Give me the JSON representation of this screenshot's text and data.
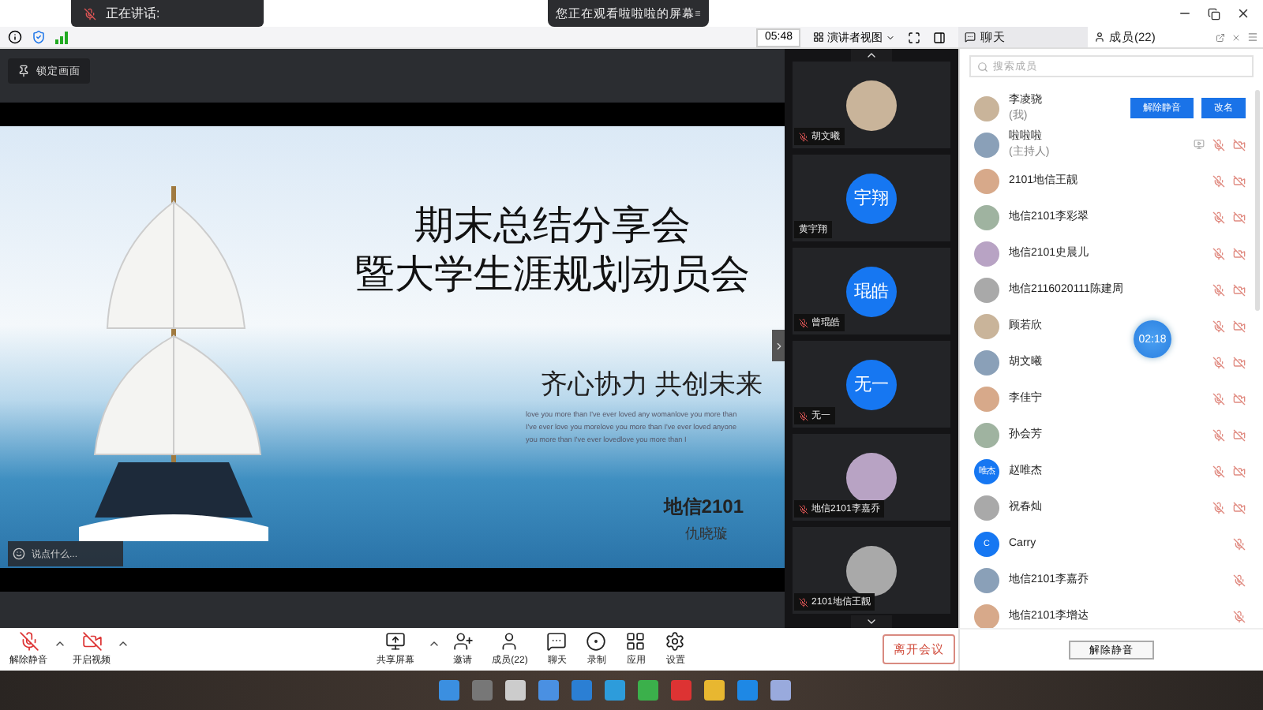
{
  "top_bar": {
    "speaking_label": "正在讲话:",
    "screen_banner": "您正在观看啦啦啦的屏幕"
  },
  "toolbar": {
    "timer": "05:48",
    "view_mode": "演讲者视图"
  },
  "panel_tabs": [
    {
      "label": "聊天",
      "selected": false
    },
    {
      "label": "成员(22)",
      "selected": true
    }
  ],
  "lock_button": "锁定画面",
  "slide": {
    "title_lines": [
      "期末总结分享会",
      "暨大学生涯规划动员会"
    ],
    "slogan": "齐心协力 共创未来",
    "english_lines": [
      "love you more than I've ever loved any womanlove you more than",
      "I've ever love you morelove you more than I've ever loved anyone",
      "you more than I've ever lovedlove you more than I"
    ],
    "class_name": "地信2101",
    "author": "仇晓璇"
  },
  "chat_input": {
    "placeholder": "说点什么..."
  },
  "video_tiles": [
    {
      "name": "胡文曦",
      "muted": true
    },
    {
      "name": "黄宇翔",
      "initials": "宇翔",
      "muted": false
    },
    {
      "name": "曾琨皓",
      "initials": "琨皓",
      "muted": true
    },
    {
      "name": "无一",
      "initials": "无一",
      "muted": true
    },
    {
      "name": "地信2101李嘉乔",
      "muted": true
    },
    {
      "name": "2101地信王靓",
      "muted": true
    }
  ],
  "member_search": {
    "placeholder": "搜索成员"
  },
  "members": [
    {
      "kind": "self",
      "name": "李凌骁",
      "role": "(我)",
      "actions": [
        "解除静音",
        "改名"
      ]
    },
    {
      "kind": "member",
      "name": "啦啦啦",
      "role": "(主持人)",
      "sharing": true,
      "muted": true,
      "video_off": true
    },
    {
      "kind": "member",
      "name": "2101地信王靓",
      "sharing": false,
      "muted": true,
      "video_off": true
    },
    {
      "kind": "member",
      "name": "地信2101李彩翠",
      "sharing": false,
      "muted": true,
      "video_off": true
    },
    {
      "kind": "member",
      "name": "地信2101史晨儿",
      "sharing": false,
      "muted": true,
      "video_off": true
    },
    {
      "kind": "member",
      "name": "地信2116020111陈建周",
      "sharing": false,
      "muted": true,
      "video_off": true
    },
    {
      "kind": "member",
      "name": "顾若欣",
      "sharing": false,
      "muted": true,
      "video_off": true
    },
    {
      "kind": "member",
      "name": "胡文曦",
      "sharing": false,
      "muted": true,
      "video_off": true
    },
    {
      "kind": "member",
      "name": "李佳宁",
      "sharing": false,
      "muted": true,
      "video_off": true
    },
    {
      "kind": "member",
      "name": "孙会芳",
      "sharing": false,
      "muted": true,
      "video_off": true
    },
    {
      "kind": "member",
      "name": "赵唯杰",
      "initials": "唯杰",
      "sharing": false,
      "muted": true,
      "video_off": true
    },
    {
      "kind": "member",
      "name": "祝春灿",
      "sharing": false,
      "muted": true,
      "video_off": true
    },
    {
      "kind": "member",
      "name": "Carry",
      "initials": "C",
      "sharing": false,
      "muted": true,
      "video_off": false
    },
    {
      "kind": "member",
      "name": "地信2101李嘉乔",
      "sharing": false,
      "muted": true,
      "video_off": false
    },
    {
      "kind": "member",
      "name": "地信2101李增达",
      "sharing": false,
      "muted": true,
      "video_off": false
    }
  ],
  "timer_bubble": "02:18",
  "panel_footer_button": "解除静音",
  "controls_left": [
    {
      "label": "解除静音",
      "caret": true
    },
    {
      "label": "开启视频",
      "caret": true
    }
  ],
  "controls_center": [
    {
      "label": "共享屏幕",
      "caret": true
    },
    {
      "label": "邀请",
      "caret": false
    },
    {
      "label": "成员(22)",
      "caret": false
    },
    {
      "label": "聊天",
      "caret": false
    },
    {
      "label": "录制",
      "caret": false
    },
    {
      "label": "应用",
      "caret": false
    },
    {
      "label": "设置",
      "caret": false
    }
  ],
  "leave_button": "离开会议"
}
